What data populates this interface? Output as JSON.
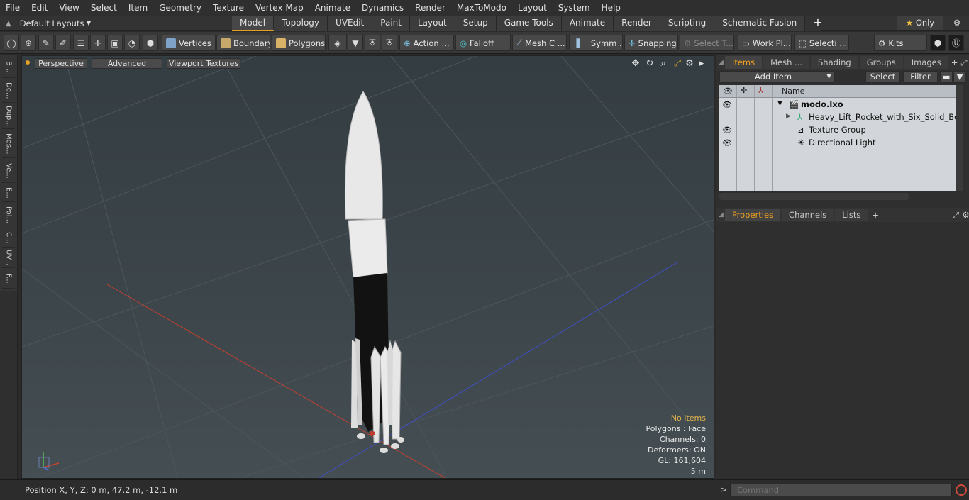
{
  "menubar": {
    "items": [
      "File",
      "Edit",
      "View",
      "Select",
      "Item",
      "Geometry",
      "Texture",
      "Vertex Map",
      "Animate",
      "Dynamics",
      "Render",
      "MaxToModo",
      "Layout",
      "System",
      "Help"
    ]
  },
  "tabbar": {
    "layouts_label": "Default Layouts",
    "tabs": [
      "Model",
      "Topology",
      "UVEdit",
      "Paint",
      "Layout",
      "Setup",
      "Game Tools",
      "Animate",
      "Render",
      "Scripting",
      "Schematic Fusion"
    ],
    "active_tab": "Model",
    "only_label": "Only"
  },
  "toolbar": {
    "vertices": "Vertices",
    "boundary": "Boundary",
    "polygons": "Polygons",
    "action": "Action",
    "falloff": "Falloff",
    "mesh": "Mesh C ...",
    "symm": "Symm ...",
    "snapping": "Snapping",
    "select_t": "Select T...",
    "work_pl": "Work Pl...",
    "selecti": "Selecti ...",
    "kits": "Kits"
  },
  "lefttabs": [
    "B...",
    "De...",
    "Dup...",
    "Mes...",
    "Ve...",
    "E...",
    "Pol...",
    "C...",
    "UV...",
    "F..."
  ],
  "viewport": {
    "perspective": "Perspective",
    "advanced": "Advanced",
    "viewport_textures": "Viewport Textures",
    "stats": {
      "no_items": "No Items",
      "polygons": "Polygons : Face",
      "channels": "Channels: 0",
      "deformers": "Deformers: ON",
      "gl": "GL: 161,604",
      "scale": "5 m"
    }
  },
  "statusbar": {
    "position": "Position X, Y, Z:  0 m, 47.2 m, -12.1 m"
  },
  "items_panel": {
    "tabs": [
      "Items",
      "Mesh ...",
      "Shading",
      "Groups",
      "Images"
    ],
    "add_item": "Add Item",
    "select": "Select",
    "filter": "Filter",
    "name_header": "Name",
    "rows": [
      {
        "label": "modo.lxo"
      },
      {
        "label": "Heavy_Lift_Rocket_with_Six_Solid_Boo ..."
      },
      {
        "label": "Texture Group"
      },
      {
        "label": "Directional Light"
      }
    ]
  },
  "properties_panel": {
    "tabs": [
      "Properties",
      "Channels",
      "Lists"
    ]
  },
  "command": {
    "placeholder": "Command"
  },
  "colors": {
    "accent": "#e6a024",
    "x_axis": "#c8402e",
    "z_axis": "#3f4fc8",
    "list_bg": "#d2d6da"
  }
}
